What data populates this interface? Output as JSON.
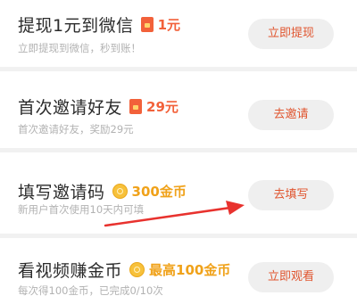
{
  "tasks": [
    {
      "title": "提现1元到微信",
      "reward_icon": "red-packet-icon",
      "reward": "1元",
      "reward_color": "#f2613a",
      "desc": "立即提现到微信，秒到账！",
      "button": "立即提现"
    },
    {
      "title": "首次邀请好友",
      "reward_icon": "red-packet-icon",
      "reward": "29元",
      "reward_color": "#f2613a",
      "desc": "首次邀请好友，奖励29元",
      "button": "去邀请"
    },
    {
      "title": "填写邀请码",
      "reward_icon": "gold-coin-icon",
      "reward": "300金币",
      "reward_color": "#f0a21a",
      "desc": "新用户首次使用10天内可填",
      "button": "去填写"
    },
    {
      "title": "看视频赚金币",
      "reward_icon": "gold-coin-icon",
      "reward": "最高100金币",
      "reward_color": "#f0a21a",
      "desc": "每次得100金币，已完成0/10次",
      "button": "立即观看"
    }
  ],
  "colors": {
    "accent": "#e0552f",
    "annotation_arrow": "#e8322e",
    "divider": "#f1f1f1"
  }
}
